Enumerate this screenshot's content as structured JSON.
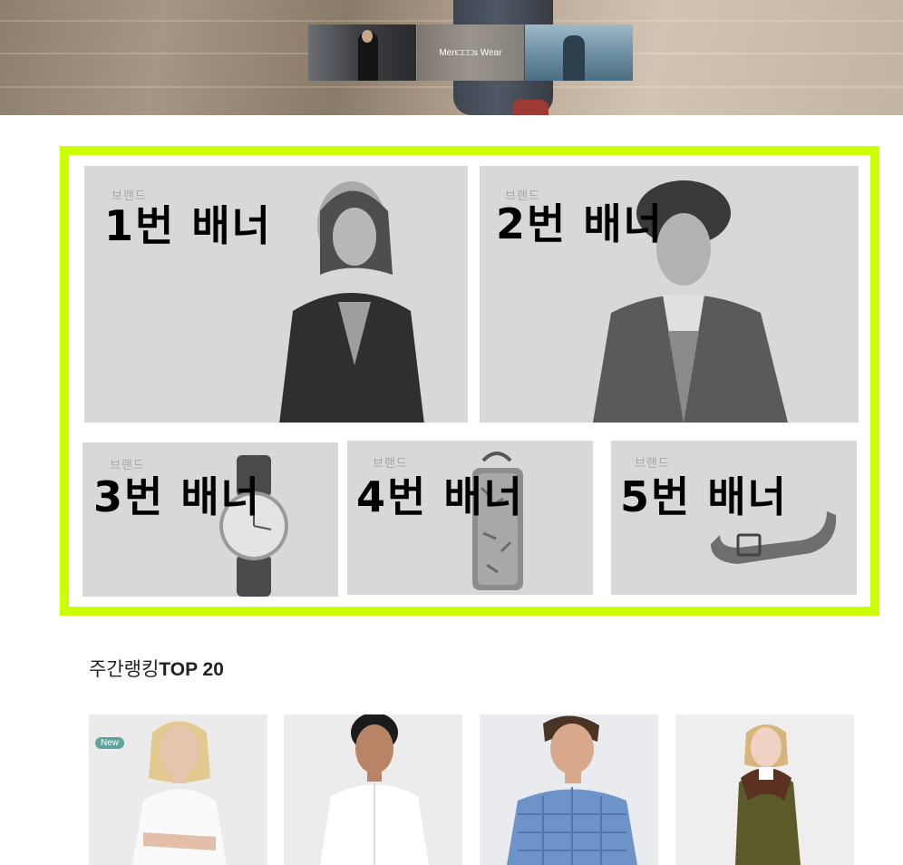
{
  "hero": {
    "thumbnails": [
      {
        "label": ""
      },
      {
        "label": "Men□□□s Wear"
      },
      {
        "label": ""
      }
    ]
  },
  "banners": [
    {
      "brand": "브랜드",
      "title": "1번 배너"
    },
    {
      "brand": "브랜드",
      "title": "2번 배너"
    },
    {
      "brand": "브랜드",
      "title": "3번 배너"
    },
    {
      "brand": "브랜드",
      "title": "4번 배너"
    },
    {
      "brand": "브랜드",
      "title": "5번 배너"
    }
  ],
  "ranking": {
    "title_prefix": "주간랭킹",
    "title_strong": "TOP 20",
    "products": [
      {
        "badge": "New",
        "image": "woman-white-tee"
      },
      {
        "badge": "",
        "image": "woman-white-shirt"
      },
      {
        "badge": "",
        "image": "man-blue-check-shirt"
      },
      {
        "badge": "",
        "image": "woman-olive-coat"
      }
    ]
  },
  "colors": {
    "banner_frame": "#ccff00",
    "banner_bg": "#d8d8d8",
    "new_badge": "#5fa3a0"
  }
}
